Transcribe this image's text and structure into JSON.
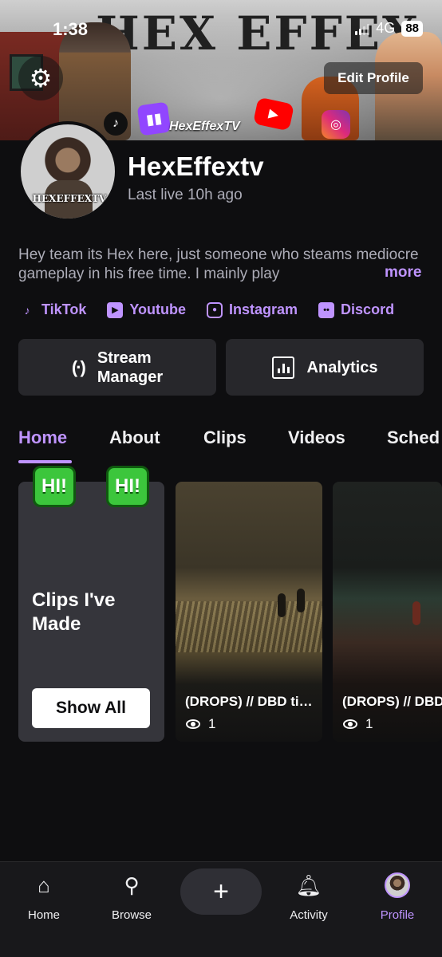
{
  "status_bar": {
    "time": "1:38",
    "network": "4G",
    "battery": "88"
  },
  "banner": {
    "title": "HEX EFFEX",
    "channel_handle": "HexEffexTV"
  },
  "header": {
    "edit_profile_label": "Edit Profile"
  },
  "profile": {
    "display_name": "HexEffextv",
    "last_live": "Last live 10h ago",
    "avatar_tag": "HEXEFFEXTV",
    "bio": "Hey team its Hex here, just someone who steams mediocre gameplay in his free time. I mainly play",
    "bio_more": "more"
  },
  "social_links": [
    {
      "label": "TikTok",
      "icon": "tiktok-icon"
    },
    {
      "label": "Youtube",
      "icon": "youtube-icon"
    },
    {
      "label": "Instagram",
      "icon": "instagram-icon"
    },
    {
      "label": "Discord",
      "icon": "discord-icon"
    }
  ],
  "actions": {
    "stream_manager_line1": "Stream",
    "stream_manager_line2": "Manager",
    "analytics": "Analytics"
  },
  "tabs": [
    {
      "label": "Home",
      "active": true
    },
    {
      "label": "About",
      "active": false
    },
    {
      "label": "Clips",
      "active": false
    },
    {
      "label": "Videos",
      "active": false
    },
    {
      "label": "Sched",
      "active": false
    }
  ],
  "clips_card": {
    "title_line1": "Clips I've",
    "title_line2": "Made",
    "button": "Show All",
    "emote": "HI!"
  },
  "clips": [
    {
      "title": "(DROPS) // DBD tiers",
      "views": "1"
    },
    {
      "title": "(DROPS) // DBD",
      "views": "1"
    }
  ],
  "bottom_nav": [
    {
      "label": "Home",
      "icon": "home-icon"
    },
    {
      "label": "Browse",
      "icon": "search-icon"
    },
    {
      "label": "Activity",
      "icon": "bell-icon"
    },
    {
      "label": "Profile",
      "icon": "profile-avatar",
      "active": true
    }
  ],
  "colors": {
    "accent": "#bf94ff",
    "background": "#0e0e10",
    "card": "#35353b",
    "button": "#27272b"
  }
}
